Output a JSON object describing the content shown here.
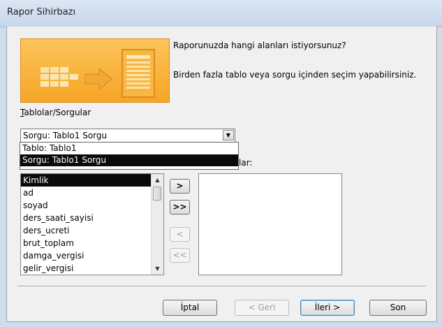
{
  "window": {
    "title": "Rapor Sihirbazı"
  },
  "description": {
    "question": "Raporunuzda hangi alanları istiyorsunuz?",
    "hint": "Birden fazla tablo veya sorgu içinden seçim yapabilirsiniz."
  },
  "tables_label": "Tablolar/Sorgular",
  "combo": {
    "value": "Sorgu: Tablo1 Sorgu",
    "options": [
      "Tablo: Tablo1",
      "Sorgu: Tablo1 Sorgu"
    ]
  },
  "selected_label_partial": "lar:",
  "available_fields": [
    "Kimlik",
    "ad",
    "soyad",
    "ders_saati_sayisi",
    "ders_ucreti",
    "brut_toplam",
    "damga_vergisi",
    "gelir_vergisi"
  ],
  "move_buttons": {
    "add_one": ">",
    "add_all": ">>",
    "remove_one": "<",
    "remove_all": "<<"
  },
  "buttons": {
    "cancel": "İptal",
    "back": "< Geri",
    "next": "İleri >",
    "finish": "Son"
  }
}
